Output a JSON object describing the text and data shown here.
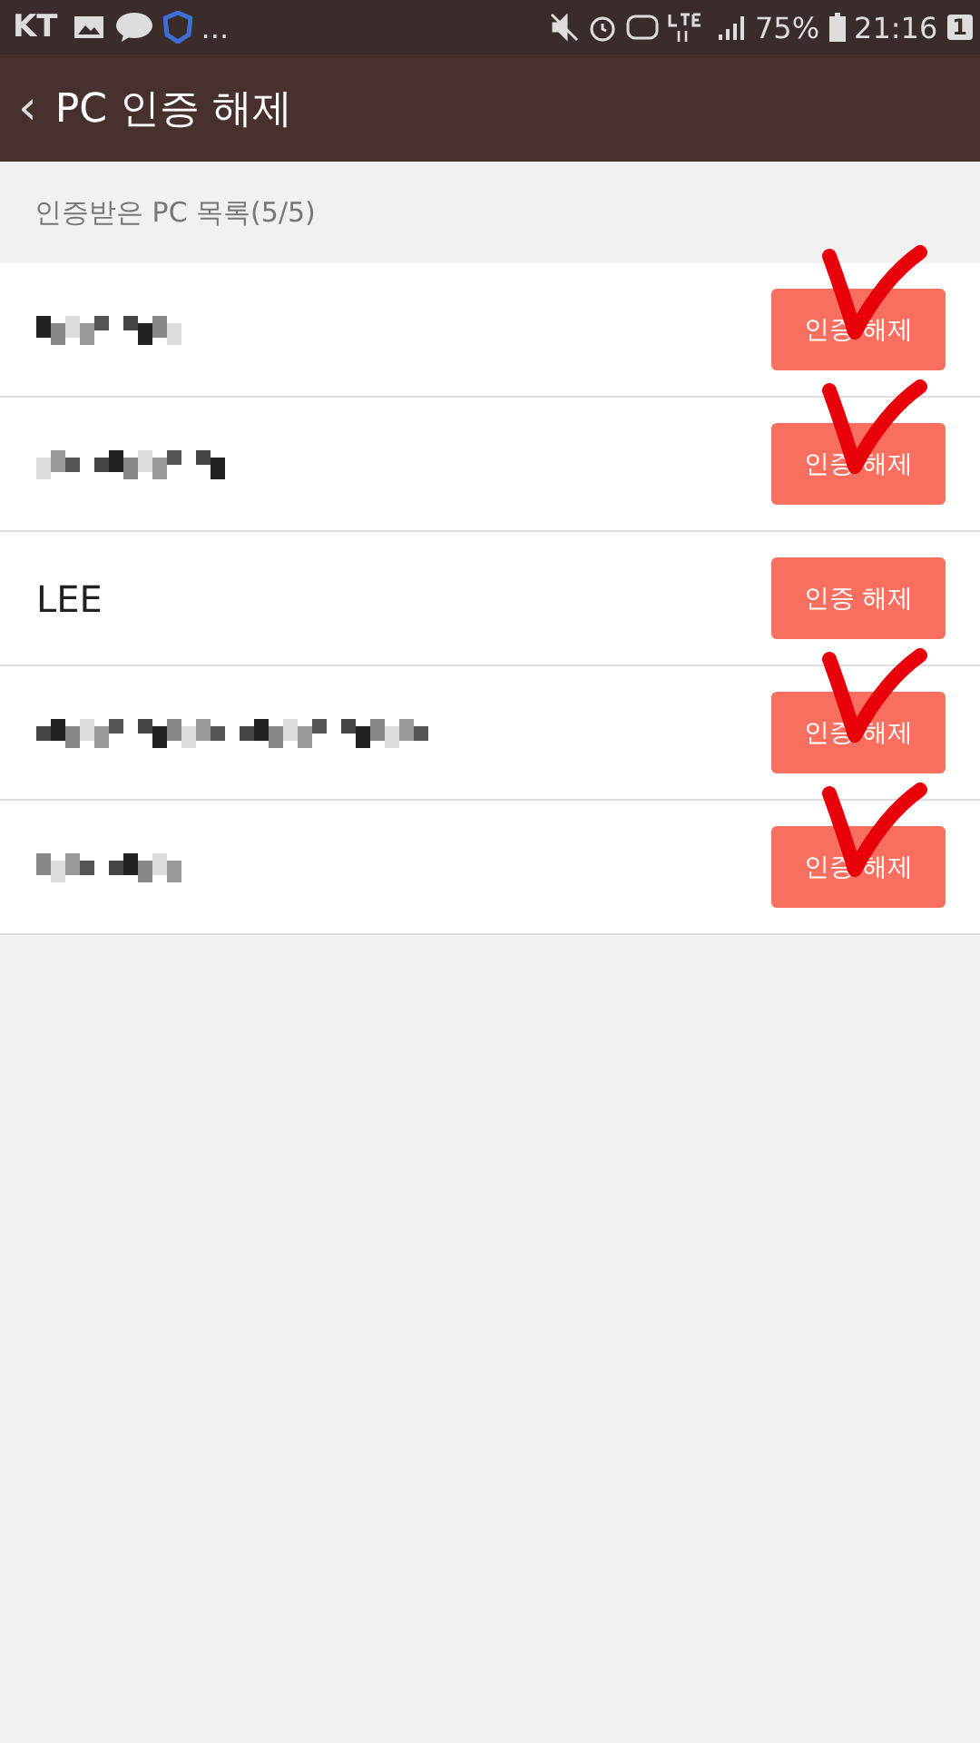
{
  "status_bar": {
    "carrier": "KT",
    "more": "...",
    "battery": "75%",
    "time": "21:16",
    "notification_count": "1"
  },
  "app_bar": {
    "back": "‹",
    "title": "PC 인증 해제"
  },
  "section_header": "인증받은 PC 목록(5/5)",
  "devices": [
    {
      "kind": "redacted",
      "button": "인증 해제",
      "marked": true
    },
    {
      "kind": "redacted",
      "button": "인증 해제",
      "marked": true
    },
    {
      "kind": "text",
      "name": "LEE",
      "button": "인증 해제",
      "marked": false
    },
    {
      "kind": "redacted",
      "button": "인증 해제",
      "marked": true
    },
    {
      "kind": "redacted",
      "button": "인증 해제",
      "marked": true
    }
  ]
}
